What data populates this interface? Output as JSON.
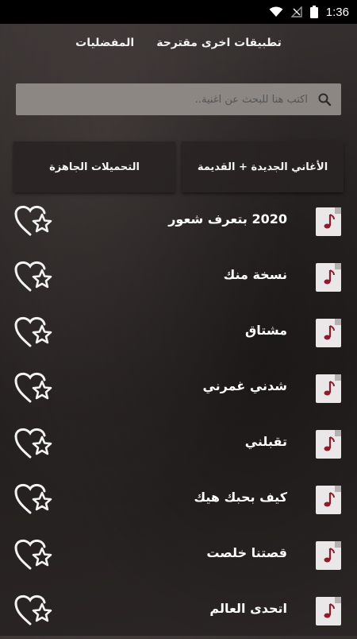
{
  "status_bar": {
    "time": "1:36"
  },
  "menu": {
    "suggested_apps": "تطبيقات اخرى مقترحة",
    "favorites": "المفضليات"
  },
  "search": {
    "placeholder": "اكتب هنا للبحث عن اغنية.."
  },
  "tabs": {
    "new_old_songs": "الأغاني الجديدة + القديمة",
    "ready_downloads": "التحميلات الجاهزة"
  },
  "songs": [
    {
      "title": "2020 بتعرف شعور"
    },
    {
      "title": "نسخة منك"
    },
    {
      "title": "مشتاق"
    },
    {
      "title": "شدني غمرني"
    },
    {
      "title": "تقبلني"
    },
    {
      "title": "كيف بحبك هيك"
    },
    {
      "title": "قصتنا خلصت"
    },
    {
      "title": "اتحدى العالم"
    }
  ],
  "icons": {
    "song_item": "music-note-icon",
    "favorite": "heart-star-icon",
    "search": "search-icon",
    "wifi": "wifi-icon",
    "signal": "signal-icon",
    "battery": "battery-icon"
  }
}
